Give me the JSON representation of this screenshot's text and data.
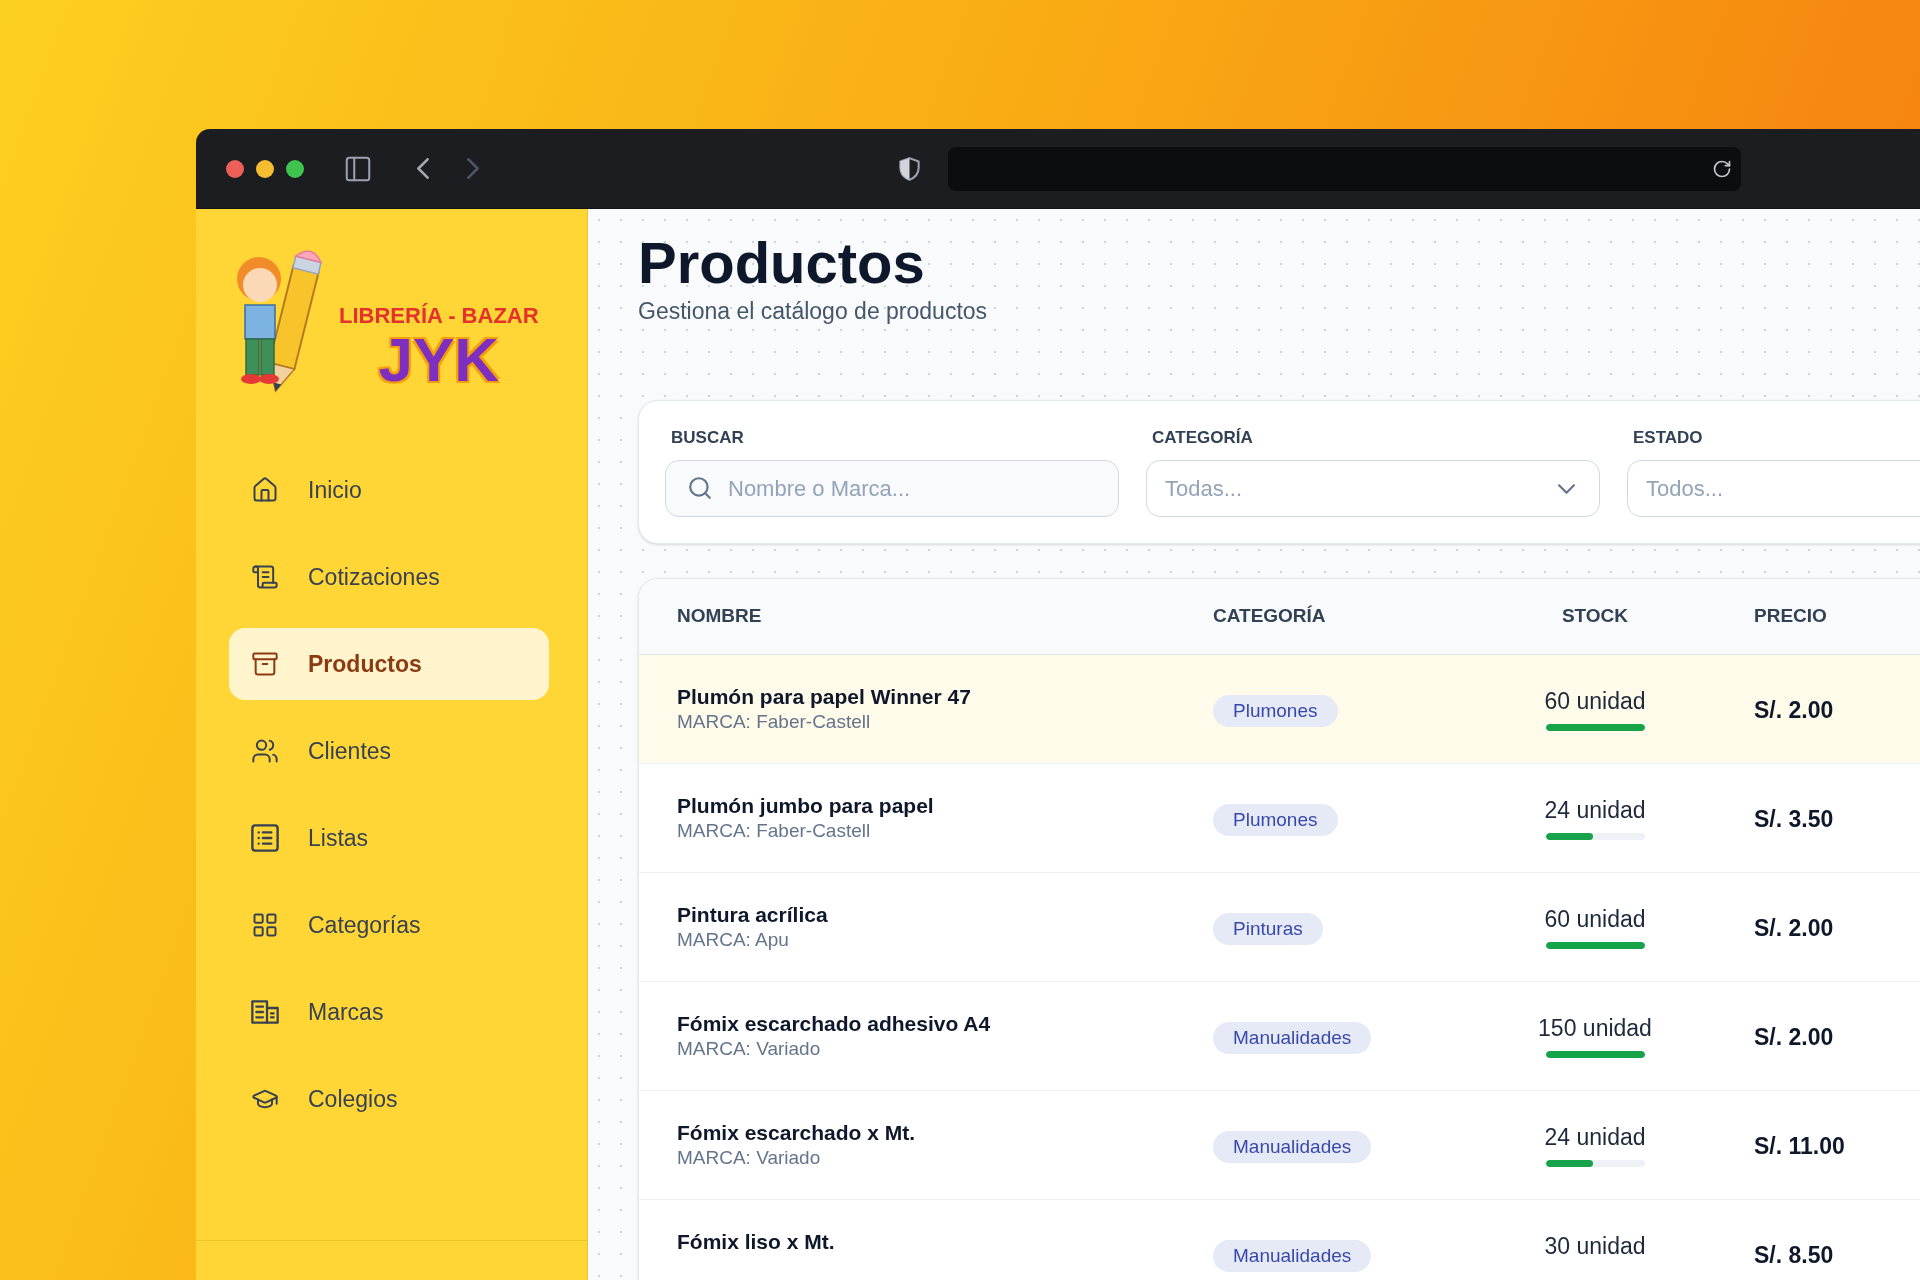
{
  "browser": {
    "back": {
      "disabled": false
    },
    "forward": {
      "disabled": true
    }
  },
  "logo": {
    "line_1": "LIBRERÍA - BAZAR",
    "line_2": "JYK"
  },
  "sidebar": {
    "items": [
      {
        "label": "Inicio",
        "selected": false
      },
      {
        "label": "Cotizaciones",
        "selected": false
      },
      {
        "label": "Productos",
        "selected": true
      },
      {
        "label": "Clientes",
        "selected": false
      },
      {
        "label": "Listas",
        "selected": false
      },
      {
        "label": "Categorías",
        "selected": false
      },
      {
        "label": "Marcas",
        "selected": false
      },
      {
        "label": "Colegios",
        "selected": false
      }
    ]
  },
  "page": {
    "title": "Productos",
    "subtitle": "Gestiona el catálogo de productos"
  },
  "filters": [
    {
      "kind": "search",
      "label": "BUSCAR",
      "placeholder": "Nombre o Marca..."
    },
    {
      "kind": "select",
      "label": "CATEGORÍA",
      "placeholder": "Todas..."
    },
    {
      "kind": "select",
      "label": "ESTADO",
      "placeholder": "Todos..."
    }
  ],
  "table": {
    "columns": [
      "NOMBRE",
      "CATEGORÍA",
      "STOCK",
      "PRECIO"
    ],
    "rows": [
      {
        "name": "Plumón para papel Winner 47",
        "brand": "MARCA: Faber-Castell",
        "category": "Plumones",
        "stock": "60 unidad",
        "level": 1,
        "price": "S/. 2.00",
        "highlighted": true
      },
      {
        "name": "Plumón jumbo para papel",
        "brand": "MARCA: Faber-Castell",
        "category": "Plumones",
        "stock": "24 unidad",
        "level": 0.48,
        "price": "S/. 3.50",
        "highlighted": false
      },
      {
        "name": "Pintura acrílica",
        "brand": "MARCA: Apu",
        "category": "Pinturas",
        "stock": "60 unidad",
        "level": 1,
        "price": "S/. 2.00",
        "highlighted": false
      },
      {
        "name": "Fómix escarchado adhesivo A4",
        "brand": "MARCA: Variado",
        "category": "Manualidades",
        "stock": "150 unidad",
        "level": 1,
        "price": "S/. 2.00",
        "highlighted": false
      },
      {
        "name": "Fómix escarchado x Mt.",
        "brand": "MARCA: Variado",
        "category": "Manualidades",
        "stock": "24 unidad",
        "level": 0.48,
        "price": "S/. 11.00",
        "highlighted": false
      },
      {
        "name": "Fómix liso x Mt.",
        "category": "Manualidades",
        "stock": "30 unidad",
        "price": "S/. 8.50",
        "highlighted": false
      }
    ]
  }
}
